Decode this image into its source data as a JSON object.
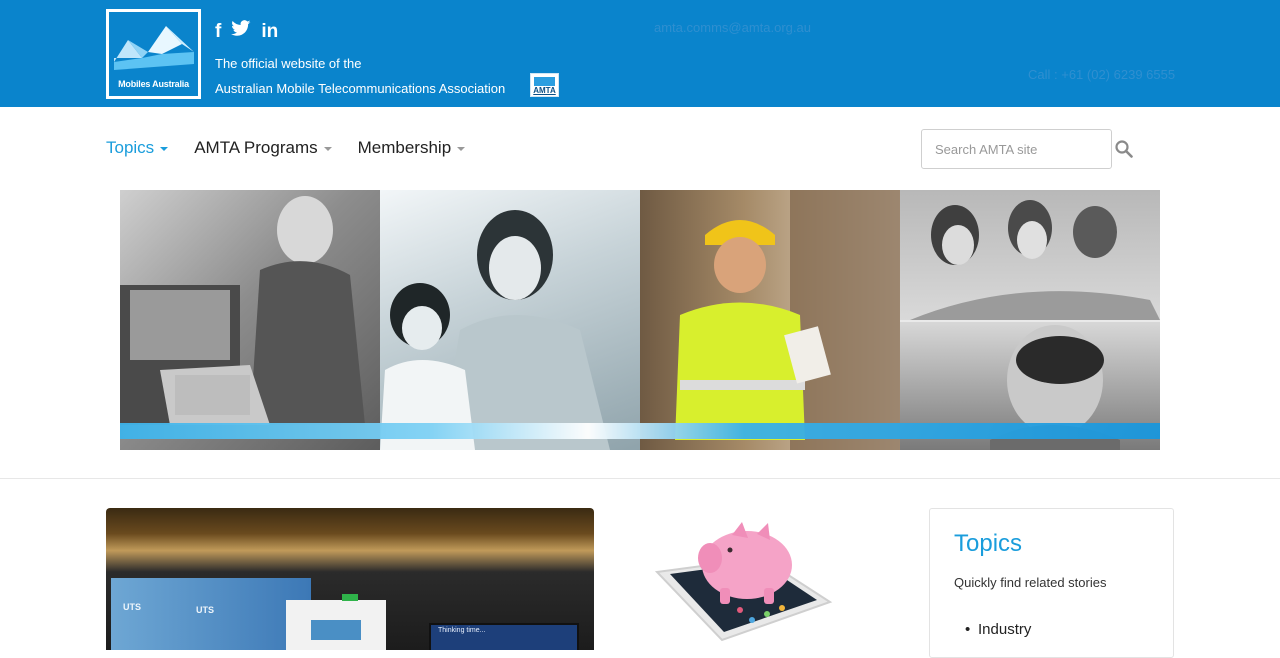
{
  "header": {
    "logo_text": "Mobiles Australia",
    "social": [
      {
        "name": "facebook",
        "glyph": "f"
      },
      {
        "name": "twitter",
        "glyph": "t"
      },
      {
        "name": "linkedin",
        "glyph": "in"
      }
    ],
    "tagline_line1": "The official website of the",
    "tagline_line2": "Australian Mobile Telecommunications Association",
    "amta_badge": "AMTA",
    "email": "amta.comms@amta.org.au",
    "phone": "Call : +61 (02) 6239 6555",
    "brand_color": "#0a84cc"
  },
  "nav": {
    "items": [
      {
        "label": "Topics",
        "active": true
      },
      {
        "label": "AMTA Programs",
        "active": false
      },
      {
        "label": "Membership",
        "active": false
      }
    ],
    "search_placeholder": "Search AMTA site",
    "accent_color": "#1a9ddc"
  },
  "content": {
    "feature_photo": {
      "uts_label_1": "UTS",
      "uts_label_2": "UTS",
      "screen_text": "Thinking time..."
    },
    "topics": {
      "title": "Topics",
      "subtitle": "Quickly find related stories",
      "items": [
        "Industry"
      ]
    }
  }
}
